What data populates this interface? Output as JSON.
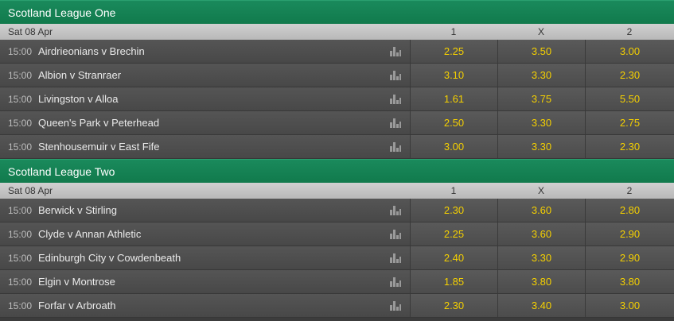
{
  "columns": [
    "1",
    "X",
    "2"
  ],
  "leagues": [
    {
      "name": "Scotland League One",
      "date": "Sat 08 Apr",
      "matches": [
        {
          "time": "15:00",
          "teams": "Airdrieonians v Brechin",
          "odds": [
            "2.25",
            "3.50",
            "3.00"
          ]
        },
        {
          "time": "15:00",
          "teams": "Albion v Stranraer",
          "odds": [
            "3.10",
            "3.30",
            "2.30"
          ]
        },
        {
          "time": "15:00",
          "teams": "Livingston v Alloa",
          "odds": [
            "1.61",
            "3.75",
            "5.50"
          ]
        },
        {
          "time": "15:00",
          "teams": "Queen's Park v Peterhead",
          "odds": [
            "2.50",
            "3.30",
            "2.75"
          ]
        },
        {
          "time": "15:00",
          "teams": "Stenhousemuir v East Fife",
          "odds": [
            "3.00",
            "3.30",
            "2.30"
          ]
        }
      ]
    },
    {
      "name": "Scotland League Two",
      "date": "Sat 08 Apr",
      "matches": [
        {
          "time": "15:00",
          "teams": "Berwick v Stirling",
          "odds": [
            "2.30",
            "3.60",
            "2.80"
          ]
        },
        {
          "time": "15:00",
          "teams": "Clyde v Annan Athletic",
          "odds": [
            "2.25",
            "3.60",
            "2.90"
          ]
        },
        {
          "time": "15:00",
          "teams": "Edinburgh City v Cowdenbeath",
          "odds": [
            "2.40",
            "3.30",
            "2.90"
          ]
        },
        {
          "time": "15:00",
          "teams": "Elgin v Montrose",
          "odds": [
            "1.85",
            "3.80",
            "3.80"
          ]
        },
        {
          "time": "15:00",
          "teams": "Forfar v Arbroath",
          "odds": [
            "2.30",
            "3.40",
            "3.00"
          ]
        }
      ]
    }
  ],
  "icons": {
    "stats": "bar-chart-icon"
  },
  "colors": {
    "header_green": "#117a4c",
    "odds_yellow": "#f5d000"
  }
}
